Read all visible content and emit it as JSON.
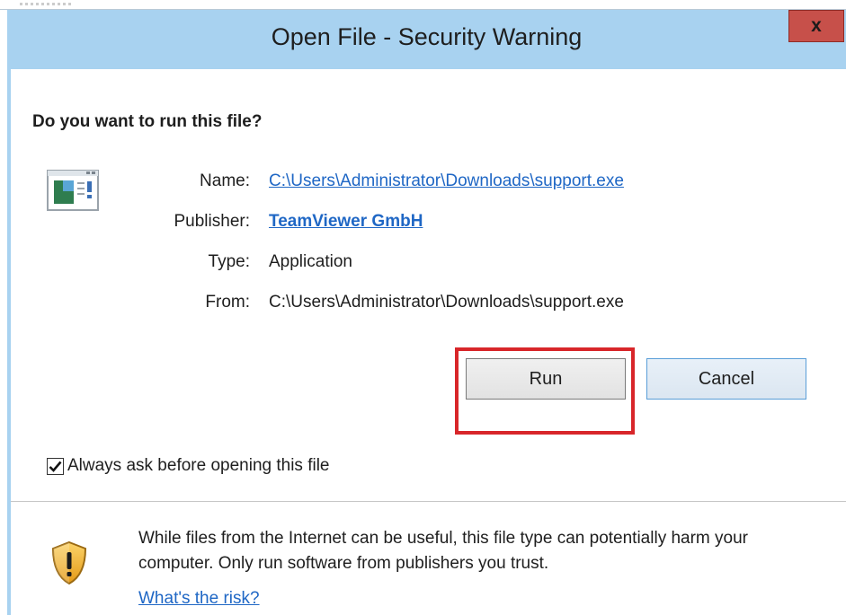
{
  "window": {
    "title": "Open File - Security Warning",
    "close_label": "x"
  },
  "prompt": {
    "question": "Do you want to run this file?"
  },
  "file_info": {
    "name_label": "Name:",
    "name_value": "C:\\Users\\Administrator\\Downloads\\support.exe",
    "publisher_label": "Publisher:",
    "publisher_value": "TeamViewer GmbH",
    "type_label": "Type:",
    "type_value": "Application",
    "from_label": "From:",
    "from_value": "C:\\Users\\Administrator\\Downloads\\support.exe"
  },
  "buttons": {
    "run_label": "Run",
    "cancel_label": "Cancel"
  },
  "options": {
    "always_ask_label": "Always ask before opening this file",
    "always_ask_checked": true
  },
  "footer": {
    "warning_text": "While files from the Internet can be useful, this file type can potentially harm your computer. Only run software from publishers you trust.",
    "risk_link_label": "What's the risk?"
  },
  "colors": {
    "titlebar": "#a8d2f0",
    "close_button": "#c7504a",
    "link": "#1f67c5",
    "highlight": "#d8262a"
  },
  "icons": {
    "app": "application-icon",
    "warning": "shield-warning-icon",
    "close": "close-icon",
    "check": "checkmark-icon"
  }
}
